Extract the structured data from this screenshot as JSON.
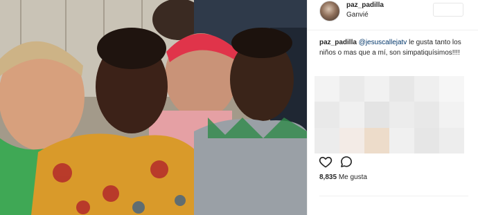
{
  "post": {
    "username": "paz_padilla",
    "location": "Ganvié",
    "caption": {
      "username": "paz_padilla",
      "mention": "@jesuscallejatv",
      "text": " le gusta tanto los niños o mas que a mí, son simpatiquísimos!!!!"
    },
    "likes_count": "8,835",
    "likes_label": "Me gusta"
  },
  "icons": {
    "like": "heart-outline-icon",
    "comment": "comment-bubble-icon"
  },
  "colors": {
    "text": "#262626",
    "mention": "#003569",
    "border": "#efefef"
  }
}
